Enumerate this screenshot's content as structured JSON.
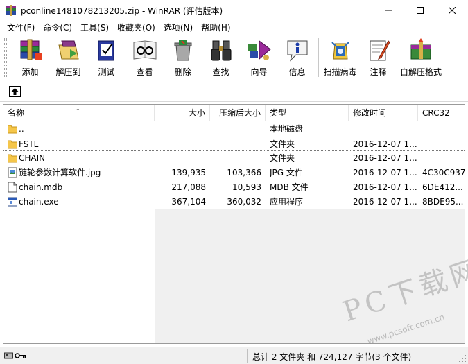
{
  "window": {
    "title": "pconline1481078213205.zip - WinRAR (评估版本)",
    "app_icon": "winrar-books-icon"
  },
  "menu": [
    {
      "label": "文件(F)"
    },
    {
      "label": "命令(C)"
    },
    {
      "label": "工具(S)"
    },
    {
      "label": "收藏夹(O)"
    },
    {
      "label": "选项(N)"
    },
    {
      "label": "帮助(H)"
    }
  ],
  "toolbar": [
    {
      "label": "添加",
      "icon": "add-archive-icon"
    },
    {
      "label": "解压到",
      "icon": "extract-to-icon"
    },
    {
      "label": "测试",
      "icon": "test-icon"
    },
    {
      "label": "查看",
      "icon": "view-glasses-icon"
    },
    {
      "label": "删除",
      "icon": "delete-icon"
    },
    {
      "label": "查找",
      "icon": "find-binoculars-icon"
    },
    {
      "label": "向导",
      "icon": "wizard-icon"
    },
    {
      "label": "信息",
      "icon": "info-icon"
    },
    {
      "label": "扫描病毒",
      "icon": "virus-scan-icon"
    },
    {
      "label": "注释",
      "icon": "comment-icon"
    },
    {
      "label": "自解压格式",
      "icon": "sfx-icon"
    }
  ],
  "columns": {
    "name": "名称",
    "size": "大小",
    "packed": "压缩后大小",
    "type": "类型",
    "modified": "修改时间",
    "crc": "CRC32"
  },
  "files": [
    {
      "name": "..",
      "size": "",
      "packed": "",
      "type": "本地磁盘",
      "modified": "",
      "crc": "",
      "icon": "folder-icon"
    },
    {
      "name": "FSTL",
      "size": "",
      "packed": "",
      "type": "文件夹",
      "modified": "2016-12-07 1...",
      "crc": "",
      "icon": "folder-icon"
    },
    {
      "name": "CHAIN",
      "size": "",
      "packed": "",
      "type": "文件夹",
      "modified": "2016-12-07 1...",
      "crc": "",
      "icon": "folder-icon"
    },
    {
      "name": "链轮参数计算软件.jpg",
      "size": "139,935",
      "packed": "103,366",
      "type": "JPG 文件",
      "modified": "2016-12-07 1...",
      "crc": "4C30C937",
      "icon": "image-file-icon"
    },
    {
      "name": "chain.mdb",
      "size": "217,088",
      "packed": "10,593",
      "type": "MDB 文件",
      "modified": "2016-12-07 1...",
      "crc": "6DE412...",
      "icon": "document-file-icon"
    },
    {
      "name": "chain.exe",
      "size": "367,104",
      "packed": "360,032",
      "type": "应用程序",
      "modified": "2016-12-07 1...",
      "crc": "8BDE95...",
      "icon": "exe-file-icon"
    }
  ],
  "status": {
    "text": "总计 2 文件夹 和 724,127 字节(3 个文件)"
  },
  "watermark": {
    "main": "PC下载网",
    "sub": "www.pcsoft.com.cn"
  },
  "colors": {
    "folder": "#f5c64a",
    "selection_border": "#777777"
  }
}
